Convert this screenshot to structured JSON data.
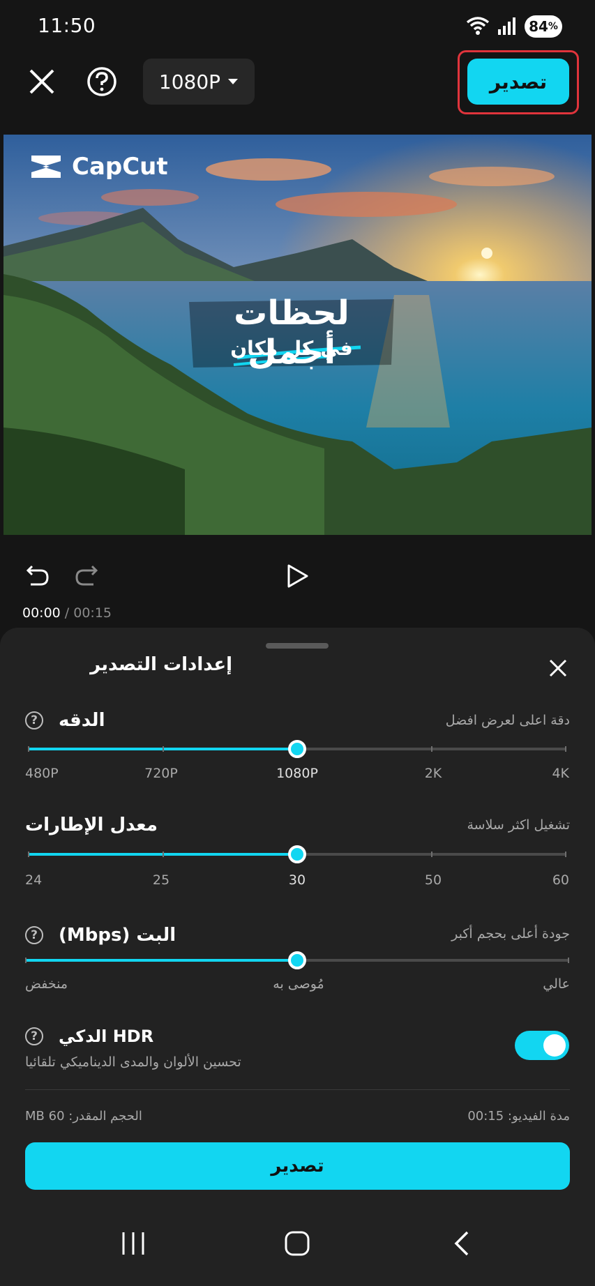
{
  "status_bar": {
    "time": "11:50",
    "battery": "84"
  },
  "toolbar": {
    "resolution": "1080P",
    "export_label": "تصدير"
  },
  "preview": {
    "brand": "CapCut",
    "headline": "لحظات أجمل",
    "subline": "في كل مكان"
  },
  "playback": {
    "current": "00:00",
    "separator": " / ",
    "total": "00:15"
  },
  "sheet": {
    "title": "إعدادات التصدير",
    "resolution": {
      "title": "الدقه",
      "hint": "دقة اعلى لعرض افضل",
      "ticks": [
        "480P",
        "720P",
        "1080P",
        "2K",
        "4K"
      ],
      "selected": "1080P",
      "value_fraction": 0.5
    },
    "frame_rate": {
      "title": "معدل الإطارات",
      "hint": "تشغيل اكثر سلاسة",
      "ticks": [
        "24",
        "25",
        "30",
        "50",
        "60"
      ],
      "selected": "30",
      "value_fraction": 0.5
    },
    "bitrate": {
      "title": "البت (Mbps)",
      "hint": "جودة أعلى بحجم أكبر",
      "labels": {
        "low": "منخفض",
        "recommended": "مُوصى به",
        "high": "عالي"
      },
      "value_fraction": 0.5
    },
    "hdr": {
      "title": "HDR الدكي",
      "description": "تحسين الألوان والمدى الديناميكي تلقائيا",
      "enabled": true
    },
    "duration": "مدة الفيديو: 00:15",
    "size": "الحجم المقدر: 60 MB",
    "export_label": "تصدير"
  },
  "colors": {
    "accent": "#12d6f1",
    "highlight_frame": "#e0343c"
  }
}
